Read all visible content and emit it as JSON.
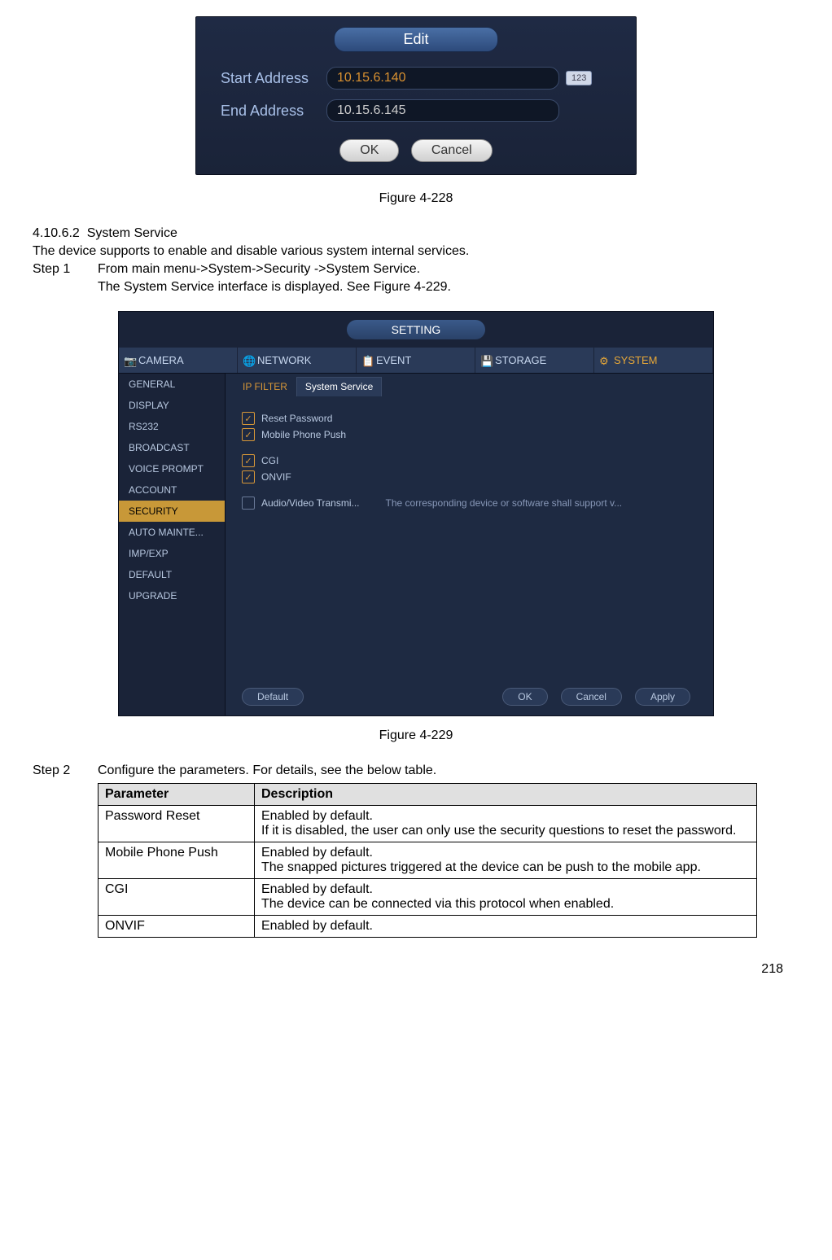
{
  "editDialog": {
    "title": "Edit",
    "startLabel": "Start Address",
    "startValue": "10.15.6.140",
    "endLabel": "End Address",
    "endValue": "10.15.6.145",
    "badge": "123",
    "ok": "OK",
    "cancel": "Cancel"
  },
  "figure1": "Figure 4-228",
  "section": {
    "num": "4.10.6.2",
    "title": "System Service",
    "intro": "The device supports to enable and disable various system internal services.",
    "step1Label": "Step 1",
    "step1Text": "From main menu->System->Security ->System Service.",
    "step1Result": "The System Service interface is displayed. See Figure 4-229."
  },
  "settingPanel": {
    "header": "SETTING",
    "tabs": [
      "CAMERA",
      "NETWORK",
      "EVENT",
      "STORAGE",
      "SYSTEM"
    ],
    "sidebar": [
      "GENERAL",
      "DISPLAY",
      "RS232",
      "BROADCAST",
      "VOICE PROMPT",
      "ACCOUNT",
      "SECURITY",
      "AUTO MAINTE...",
      "IMP/EXP",
      "DEFAULT",
      "UPGRADE"
    ],
    "subTabs": [
      "IP FILTER",
      "System Service"
    ],
    "options": {
      "reset": "Reset Password",
      "mobile": "Mobile Phone Push",
      "cgi": "CGI",
      "onvif": "ONVIF",
      "av": "Audio/Video Transmi...",
      "avDesc": "The corresponding device or software shall support v..."
    },
    "buttons": {
      "default": "Default",
      "ok": "OK",
      "cancel": "Cancel",
      "apply": "Apply"
    }
  },
  "figure2": "Figure 4-229",
  "step2": {
    "label": "Step 2",
    "text": "Configure the parameters. For details, see the below table."
  },
  "table": {
    "h1": "Parameter",
    "h2": "Description",
    "rows": [
      {
        "p": "Password Reset",
        "d": "Enabled by default.\nIf it is disabled, the user can only use the security questions to reset the password."
      },
      {
        "p": "Mobile Phone Push",
        "d": "Enabled by default.\nThe snapped pictures triggered at the device can be push to the mobile app."
      },
      {
        "p": "CGI",
        "d": "Enabled by default.\nThe device can be connected via this protocol when enabled."
      },
      {
        "p": "ONVIF",
        "d": "Enabled by default."
      }
    ]
  },
  "pageNum": "218"
}
